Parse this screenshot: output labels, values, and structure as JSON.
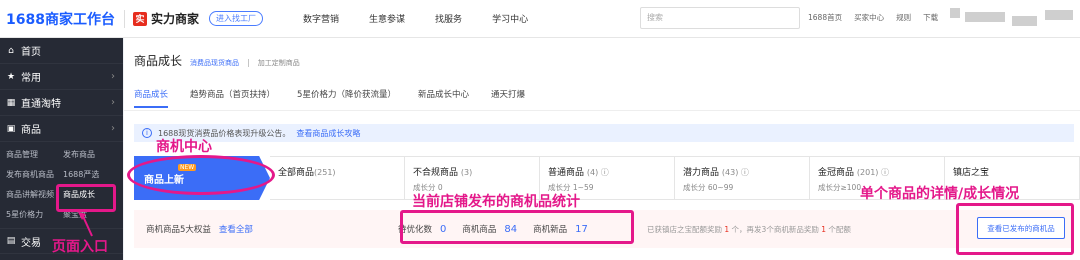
{
  "topbar": {
    "logo": "1688商家工作台",
    "brand_icon": "实",
    "brand": "实力商家",
    "brand_button": "进入找工厂",
    "nav": [
      "数字营销",
      "生意参谋",
      "找服务",
      "学习中心"
    ],
    "search_placeholder": "搜索",
    "links": [
      "1688首页",
      "买家中心",
      "规则",
      "下载"
    ]
  },
  "sidebar": {
    "items": [
      {
        "icon": "home-icon",
        "label": "首页"
      },
      {
        "icon": "star-icon",
        "label": "常用"
      },
      {
        "icon": "flow-icon",
        "label": "直通淘特"
      },
      {
        "icon": "goods-icon",
        "label": "商品"
      }
    ],
    "sub": [
      "商品管理",
      "发布商品",
      "发布商机商品",
      "1688严选",
      "商品讲解视频",
      "商品成长",
      "5星价格力",
      "聚宝盆"
    ],
    "bottom": {
      "icon": "trade-icon",
      "label": "交易"
    }
  },
  "main": {
    "title": "商品成长",
    "breadcrumb_link": "消费品现货商品",
    "breadcrumb_sep": "|",
    "breadcrumb_plain": "加工定制商品",
    "tabs": [
      "商品成长",
      "趋势商品（首页扶持）",
      "5星价格力（降价获流量）",
      "新品成长中心",
      "通天打爆"
    ],
    "notice_icon": "i",
    "notice": "1688现货消费品价格表现升级公告。",
    "notice_link": "查看商品成长攻略",
    "first_card": "商品上新",
    "first_badge": "NEW",
    "cards": [
      {
        "title": "全部商品",
        "count": "(251)",
        "sub": ""
      },
      {
        "title": "不合规商品",
        "count": "(3)",
        "sub": "成长分 0"
      },
      {
        "title": "普通商品",
        "count": "(4) ⓘ",
        "sub": "成长分 1~59"
      },
      {
        "title": "潜力商品",
        "count": "(43) ⓘ",
        "sub": "成长分 60~99"
      },
      {
        "title": "金冠商品",
        "count": "(201) ⓘ",
        "sub": "成长分≥100"
      },
      {
        "title": "镇店之宝",
        "count": "",
        "sub": ""
      }
    ],
    "stats_label": "商机商品5大权益",
    "stats_link": "查看全部",
    "stats": [
      {
        "label": "待优化数",
        "value": "0"
      },
      {
        "label": "商机商品",
        "value": "84"
      },
      {
        "label": "商机新品",
        "value": "17"
      }
    ],
    "msg_a": "已获镇店之宝配额奖励 ",
    "msg_n1": "1",
    "msg_b": " 个，再发3个商机新品奖励 ",
    "msg_n2": "1",
    "msg_c": " 个配额",
    "button": "查看已发布的商机品"
  },
  "annotations": {
    "center": "商机中心",
    "stats": "当前店铺发布的商机品统计",
    "details": "单个商品的详情/成长情况",
    "entry": "页面入口"
  }
}
